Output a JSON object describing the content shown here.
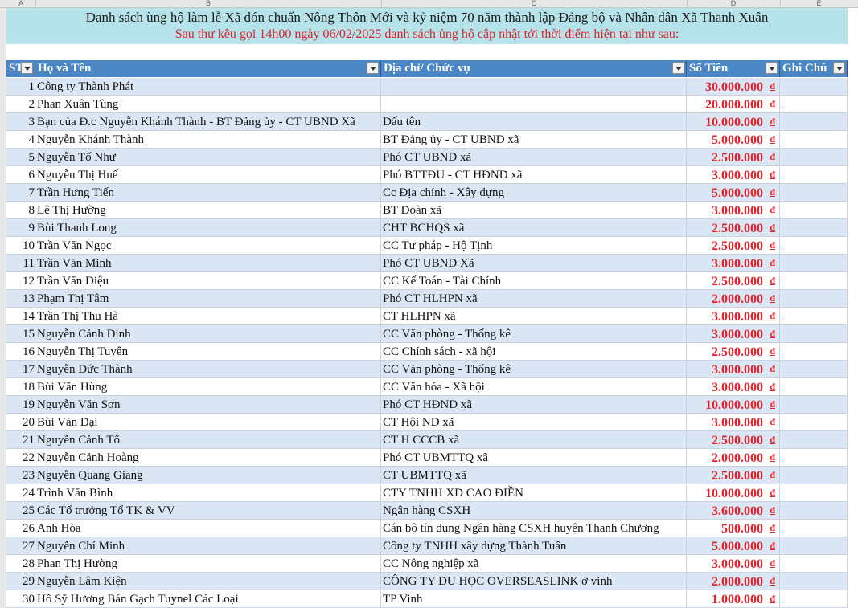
{
  "column_letters": [
    "A",
    "B",
    "C",
    "D",
    "E"
  ],
  "row_numbers": [
    "",
    "",
    "",
    "",
    "",
    "",
    "",
    "",
    "",
    "",
    "",
    "",
    "",
    "",
    "",
    "",
    "",
    "",
    "",
    "",
    "",
    "",
    "",
    "",
    "",
    "",
    "",
    "",
    "",
    "",
    "",
    "",
    "",
    ""
  ],
  "title": "Danh sách ùng hộ làm lễ Xã đón chuẩn Nông Thôn Mới và kỷ niệm 70 năm thành lập Đảng bộ và Nhân dân Xã Thanh Xuân",
  "subtitle": "Sau thư kêu gọi 14h00 ngày 06/02/2025 danh sách ủng hộ cập nhật tới thời điểm hiện tại như sau:",
  "headers": {
    "stt": "ST",
    "name": "Họ và Tên",
    "address": "Địa chỉ/ Chức vụ",
    "amount": "Số Tiền",
    "note": "Ghi Chú"
  },
  "currency_symbol": "đ",
  "colors": {
    "header_bg": "#4b86c5",
    "title_bg": "#b6e3e9",
    "band": "#dbe6f5",
    "amount": "#e0202a",
    "subtitle": "#e0202a"
  },
  "rows": [
    {
      "stt": "1",
      "name": "Công ty Thành Phát",
      "address": "",
      "amount": "30.000.000"
    },
    {
      "stt": "2",
      "name": "Phan Xuân Tùng",
      "address": "",
      "amount": "20.000.000"
    },
    {
      "stt": "3",
      "name": "Bạn của Đ.c Nguyễn Khánh Thành - BT Đảng ủy - CT UBND Xã",
      "address": "Dấu tên",
      "amount": "10.000.000"
    },
    {
      "stt": "4",
      "name": "Nguyễn Khánh Thành",
      "address": "BT Đảng ủy - CT UBND xã",
      "amount": "5.000.000"
    },
    {
      "stt": "5",
      "name": "Nguyễn Tố Như",
      "address": "Phó CT UBND xã",
      "amount": "2.500.000"
    },
    {
      "stt": "6",
      "name": "Nguyễn Thị Huế",
      "address": "Phó BTTĐU - CT HĐND xã",
      "amount": "3.000.000"
    },
    {
      "stt": "7",
      "name": "Trần Hưng Tiến",
      "address": "Cc Địa chính - Xây dựng",
      "amount": "5.000.000"
    },
    {
      "stt": "8",
      "name": "Lê Thị Hường",
      "address": "BT Đoàn xã",
      "amount": "3.000.000"
    },
    {
      "stt": "9",
      "name": "Bùi Thanh Long",
      "address": "CHT BCHQS xã",
      "amount": "2.500.000"
    },
    {
      "stt": "10",
      "name": "Trần Văn Ngọc",
      "address": "CC Tư pháp - Hộ Tịnh",
      "amount": "2.500.000"
    },
    {
      "stt": "11",
      "name": "Trần Văn Minh",
      "address": "Phó CT UBND Xã",
      "amount": "3.000.000"
    },
    {
      "stt": "12",
      "name": "Trần Văn Diệu",
      "address": "CC Kế Toán - Tài Chính",
      "amount": "2.500.000"
    },
    {
      "stt": "13",
      "name": "Phạm Thị Tâm",
      "address": "Phó CT HLHPN xã",
      "amount": "2.000.000"
    },
    {
      "stt": "14",
      "name": "Trần Thị Thu Hà",
      "address": "CT HLHPN xã",
      "amount": "3.000.000"
    },
    {
      "stt": "15",
      "name": "Nguyễn Cảnh Dinh",
      "address": "CC Văn phòng - Thống kê",
      "amount": "3.000.000"
    },
    {
      "stt": "16",
      "name": "Nguyễn Thị Tuyên",
      "address": "CC Chính sách - xã hội",
      "amount": "2.500.000"
    },
    {
      "stt": "17",
      "name": "Nguyễn Đức Thành",
      "address": "CC Văn phòng - Thống kê",
      "amount": "3.000.000"
    },
    {
      "stt": "18",
      "name": "Bùi Văn Hùng",
      "address": "CC Văn hóa - Xã hội",
      "amount": "3.000.000"
    },
    {
      "stt": "19",
      "name": "Nguyễn Văn Sơn",
      "address": "Phó CT HĐND xã",
      "amount": "10.000.000"
    },
    {
      "stt": "20",
      "name": "Bùi Văn Đại",
      "address": "CT Hội ND xã",
      "amount": "3.000.000"
    },
    {
      "stt": "21",
      "name": "Nguyễn Cảnh Tố",
      "address": "CT H CCCB xã",
      "amount": "2.500.000"
    },
    {
      "stt": "22",
      "name": "Nguyễn Cảnh Hoàng",
      "address": "Phó CT UBMTTQ xã",
      "amount": "2.000.000"
    },
    {
      "stt": "23",
      "name": "Nguyễn Quang Giang",
      "address": "CT UBMTTQ xã",
      "amount": "2.500.000"
    },
    {
      "stt": "24",
      "name": "Trình Văn Bình",
      "address": "CTY TNHH XD CAO ĐIỀN",
      "amount": "10.000.000"
    },
    {
      "stt": "25",
      "name": "Các Tổ trưởng Tổ TK & VV",
      "address": "Ngân hàng CSXH",
      "amount": "3.600.000"
    },
    {
      "stt": "26",
      "name": "Anh Hòa",
      "address": "Cán bộ tín dụng Ngân hàng CSXH huyện Thanh Chương",
      "amount": "500.000"
    },
    {
      "stt": "27",
      "name": "Nguyễn Chí Minh",
      "address": "Công ty TNHH xây dựng Thành Tuấn",
      "amount": "5.000.000"
    },
    {
      "stt": "28",
      "name": "Phan Thị Hường",
      "address": "CC Nông nghiệp xã",
      "amount": "3.000.000"
    },
    {
      "stt": "29",
      "name": "Nguyễn Lâm Kiện",
      "address": "CÔNG TY DU HỌC OVERSEASLINK ở vinh",
      "amount": "2.000.000"
    },
    {
      "stt": "30",
      "name": "Hồ Sỹ Hương Bán Gạch Tuynel Các Loại",
      "address": "TP Vinh",
      "amount": "1.000.000"
    }
  ]
}
